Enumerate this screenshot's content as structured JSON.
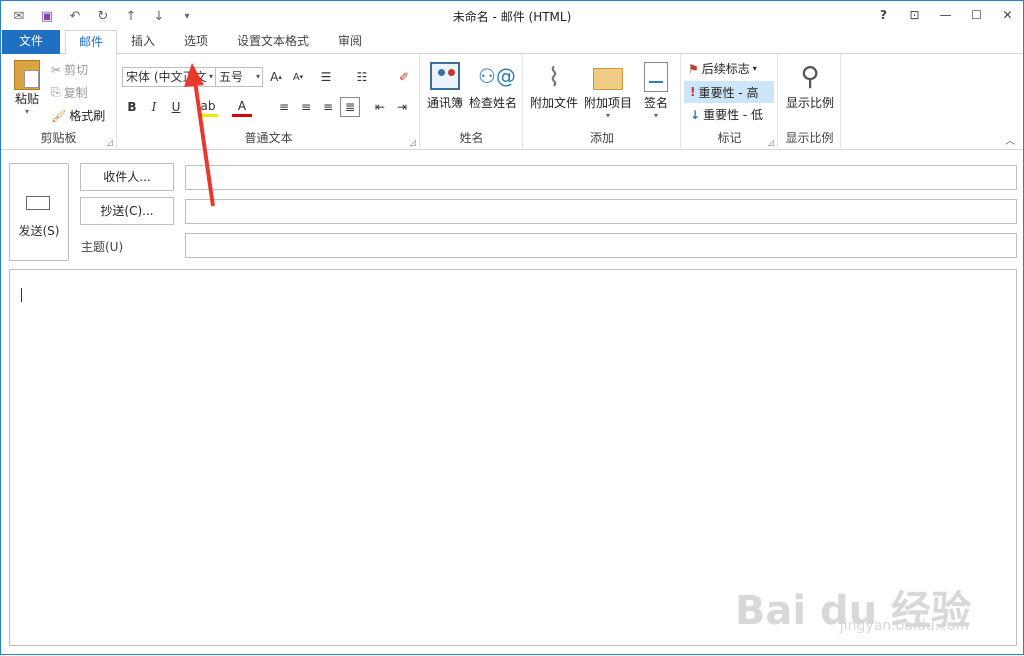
{
  "window": {
    "title": "未命名 - 邮件 (HTML)"
  },
  "titlebar": {
    "help": "?"
  },
  "tabs": [
    {
      "label": "文件"
    },
    {
      "label": "邮件"
    },
    {
      "label": "插入"
    },
    {
      "label": "选项"
    },
    {
      "label": "设置文本格式"
    },
    {
      "label": "审阅"
    }
  ],
  "ribbon": {
    "clipboard": {
      "label": "剪贴板",
      "paste": "粘贴",
      "cut": "剪切",
      "copy": "复制",
      "format_painter": "格式刷"
    },
    "basic_text": {
      "label": "普通文本",
      "font": "宋体 (中文正文",
      "size": "五号"
    },
    "names": {
      "label": "姓名",
      "address_book": "通讯簿",
      "check_names": "检查姓名"
    },
    "include": {
      "label": "添加",
      "attach_file": "附加文件",
      "attach_item": "附加项目",
      "signature": "签名"
    },
    "tags": {
      "label": "标记",
      "follow_up": "后续标志",
      "high": "重要性 - 高",
      "low": "重要性 - 低"
    },
    "zoom": {
      "label": "显示比例",
      "zoom": "显示比例"
    }
  },
  "compose": {
    "send": "发送(S)",
    "to": "收件人...",
    "cc": "抄送(C)...",
    "subject": "主题(U)"
  },
  "watermark": {
    "main": "Bai du 经验",
    "sub": "jingyan.baidu.com"
  },
  "colors": {
    "accent": "#1f6fc2",
    "arrow": "#e8392c",
    "highlight": "#cde6f7"
  }
}
